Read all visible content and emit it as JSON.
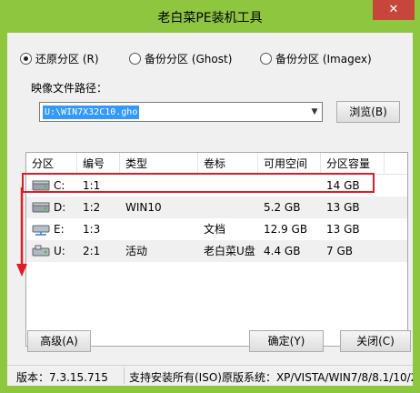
{
  "window": {
    "title": "老白菜PE装机工具",
    "close_glyph": "✕"
  },
  "mode": {
    "options": [
      {
        "label": "还原分区 (R)",
        "checked": true
      },
      {
        "label": "备份分区 (Ghost)",
        "checked": false
      },
      {
        "label": "备份分区 (Imagex)",
        "checked": false
      }
    ]
  },
  "image_path": {
    "label": "映像文件路径：",
    "value": "U:\\WIN7X32C10.gho",
    "browse_label": "浏览(B)"
  },
  "table": {
    "headers": [
      "分区",
      "编号",
      "类型",
      "卷标",
      "可用空间",
      "分区容量"
    ],
    "rows": [
      {
        "drive": "C:",
        "number": "1:1",
        "type": "",
        "label": "",
        "free": "",
        "capacity": "14 GB",
        "icon": "hdd-icon"
      },
      {
        "drive": "D:",
        "number": "1:2",
        "type": "WIN10",
        "label": "",
        "free": "5.2 GB",
        "capacity": "13 GB",
        "icon": "hdd-icon"
      },
      {
        "drive": "E:",
        "number": "1:3",
        "type": "",
        "label": "文档",
        "free": "12.9 GB",
        "capacity": "13 GB",
        "icon": "network-drive-icon"
      },
      {
        "drive": "U:",
        "number": "2:1",
        "type": "活动",
        "label": "老白菜U盘",
        "free": "4.4 GB",
        "capacity": "7 GB",
        "icon": "usb-drive-icon"
      }
    ]
  },
  "buttons": {
    "advanced": "高级(A)",
    "ok": "确定(Y)",
    "close": "关闭(C)"
  },
  "status": {
    "version": "版本：7.3.15.715",
    "support": "支持安装所有(ISO)原版系统：XP/VISTA/WIN7/8/8.1/10/2000"
  },
  "colors": {
    "accent": "#8ec63f",
    "highlight": "#e31b23",
    "selection": "#3399ff",
    "close": "#c7463c"
  }
}
